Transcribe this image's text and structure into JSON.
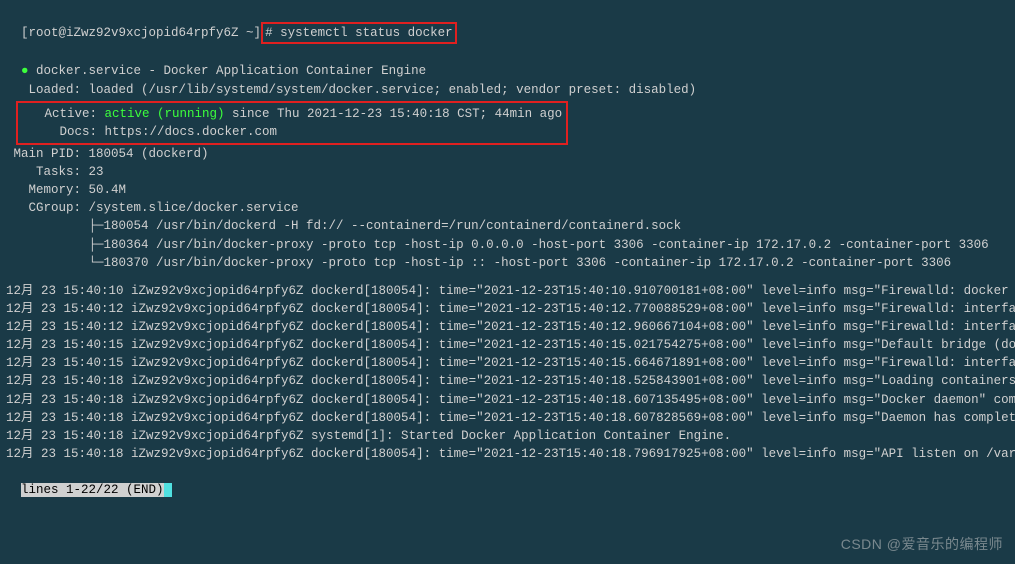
{
  "prompt": {
    "user_host": "[root@iZwz92v9xcjopid64rpfy6Z ~]",
    "command": "# systemctl status docker"
  },
  "status": {
    "service_line": " docker.service - Docker Application Container Engine",
    "loaded": "   Loaded: loaded (/usr/lib/systemd/system/docker.service; enabled; vendor preset: disabled)",
    "active_label": "   Active: ",
    "active_state": "active (running)",
    "active_since": " since Thu 2021-12-23 15:40:18 CST; 44min ago",
    "docs": "     Docs: https://docs.docker.com",
    "main_pid": " Main PID: 180054 (dockerd)",
    "tasks": "    Tasks: 23",
    "memory": "   Memory: 50.4M",
    "cgroup": "   CGroup: /system.slice/docker.service",
    "cgroup1": "           ├─180054 /usr/bin/dockerd -H fd:// --containerd=/run/containerd/containerd.sock",
    "cgroup2": "           ├─180364 /usr/bin/docker-proxy -proto tcp -host-ip 0.0.0.0 -host-port 3306 -container-ip 172.17.0.2 -container-port 3306",
    "cgroup3": "           └─180370 /usr/bin/docker-proxy -proto tcp -host-ip :: -host-port 3306 -container-ip 172.17.0.2 -container-port 3306"
  },
  "logs": [
    {
      "text": "12月 23 15:40:10 iZwz92v9xcjopid64rpfy6Z dockerd[180054]: time=\"2021-12-23T15:40:10.910700181+08:00\" level=info msg=\"Firewalld: docker zon",
      "more": ">"
    },
    {
      "text": "12月 23 15:40:12 iZwz92v9xcjopid64rpfy6Z dockerd[180054]: time=\"2021-12-23T15:40:12.770088529+08:00\" level=info msg=\"Firewalld: interface ",
      "more": ">"
    },
    {
      "text": "12月 23 15:40:12 iZwz92v9xcjopid64rpfy6Z dockerd[180054]: time=\"2021-12-23T15:40:12.960667104+08:00\" level=info msg=\"Firewalld: interface ",
      "more": ">"
    },
    {
      "text": "12月 23 15:40:15 iZwz92v9xcjopid64rpfy6Z dockerd[180054]: time=\"2021-12-23T15:40:15.021754275+08:00\" level=info msg=\"Default bridge (docke",
      "more": ">"
    },
    {
      "text": "12月 23 15:40:15 iZwz92v9xcjopid64rpfy6Z dockerd[180054]: time=\"2021-12-23T15:40:15.664671891+08:00\" level=info msg=\"Firewalld: interface ",
      "more": ">"
    },
    {
      "text": "12月 23 15:40:18 iZwz92v9xcjopid64rpfy6Z dockerd[180054]: time=\"2021-12-23T15:40:18.525843901+08:00\" level=info msg=\"Loading containers: d",
      "more": ">"
    },
    {
      "text": "12月 23 15:40:18 iZwz92v9xcjopid64rpfy6Z dockerd[180054]: time=\"2021-12-23T15:40:18.607135495+08:00\" level=info msg=\"Docker daemon\" commit",
      "more": ">"
    },
    {
      "text": "12月 23 15:40:18 iZwz92v9xcjopid64rpfy6Z dockerd[180054]: time=\"2021-12-23T15:40:18.607828569+08:00\" level=info msg=\"Daemon has completed ",
      "more": ">"
    },
    {
      "text": "12月 23 15:40:18 iZwz92v9xcjopid64rpfy6Z systemd[1]: Started Docker Application Container Engine.",
      "more": ""
    },
    {
      "text": "12月 23 15:40:18 iZwz92v9xcjopid64rpfy6Z dockerd[180054]: time=\"2021-12-23T15:40:18.796917925+08:00\" level=info msg=\"API listen on /var/ru",
      "more": ">"
    }
  ],
  "pager": "lines 1-22/22 (END)",
  "watermark": "CSDN @爱音乐的编程师",
  "annotation_boxes": {
    "box1": "command-highlight",
    "box2": "active-docs-highlight"
  }
}
